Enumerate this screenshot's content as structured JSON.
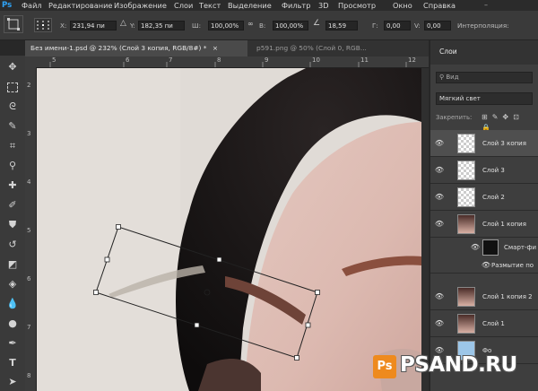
{
  "app": {
    "logo": "Ps"
  },
  "menu": [
    "Файл",
    "Редактирование",
    "Изображение",
    "Слои",
    "Текст",
    "Выделение",
    "Фильтр",
    "3D",
    "Просмотр",
    "Окно",
    "Справка"
  ],
  "options": {
    "x_label": "X:",
    "x_value": "231,94 пи",
    "y_label": "Y:",
    "y_value": "182,35 пи",
    "w_label": "Ш:",
    "w_value": "100,00%",
    "h_label": "В:",
    "h_value": "100,00%",
    "angle_value": "18,59",
    "hskew_label": "Г:",
    "hskew_value": "0,00",
    "vskew_label": "V:",
    "vskew_value": "0,00",
    "interp_label": "Интерполяция:"
  },
  "tabs": [
    {
      "label": "Без имени-1.psd @ 232% (Слой 3 копия, RGB/8#) *",
      "close": "×",
      "active": true
    },
    {
      "label": "p591.png @ 50% (Слой 0, RGB...",
      "close": "",
      "active": false
    }
  ],
  "ruler": {
    "top_ticks": [
      "5",
      "6",
      "7",
      "8",
      "9",
      "10",
      "11",
      "12"
    ],
    "left_ticks": [
      "2",
      "3",
      "4",
      "5",
      "6",
      "7",
      "8"
    ]
  },
  "layers_panel": {
    "tab_label": "Слои",
    "search_placeholder": "Вид",
    "blend_mode": "Мягкий свет",
    "lock_label": "Закрепить:",
    "layers": [
      {
        "name": "Слой 3 копия",
        "thumb": "checker",
        "selected": true,
        "visible": true
      },
      {
        "name": "Слой 3",
        "thumb": "checker",
        "selected": false,
        "visible": true
      },
      {
        "name": "Слой 2",
        "thumb": "checker",
        "selected": false,
        "visible": true
      },
      {
        "name": "Слой 1 копия",
        "thumb": "photo",
        "selected": false,
        "visible": true
      },
      {
        "name": "Смарт-фи",
        "thumb": "mask",
        "selected": false,
        "visible": false
      },
      {
        "name": "Размытие по",
        "thumb": "none",
        "selected": false,
        "visible": true
      },
      {
        "name": "Слой 1 копия 2",
        "thumb": "photo",
        "selected": false,
        "visible": true
      },
      {
        "name": "Слой 1",
        "thumb": "photo",
        "selected": false,
        "visible": true
      },
      {
        "name": "Фо",
        "thumb": "blue",
        "selected": false,
        "visible": true
      }
    ]
  },
  "watermark": {
    "badge": "Ps",
    "text": "PSAND.RU"
  }
}
